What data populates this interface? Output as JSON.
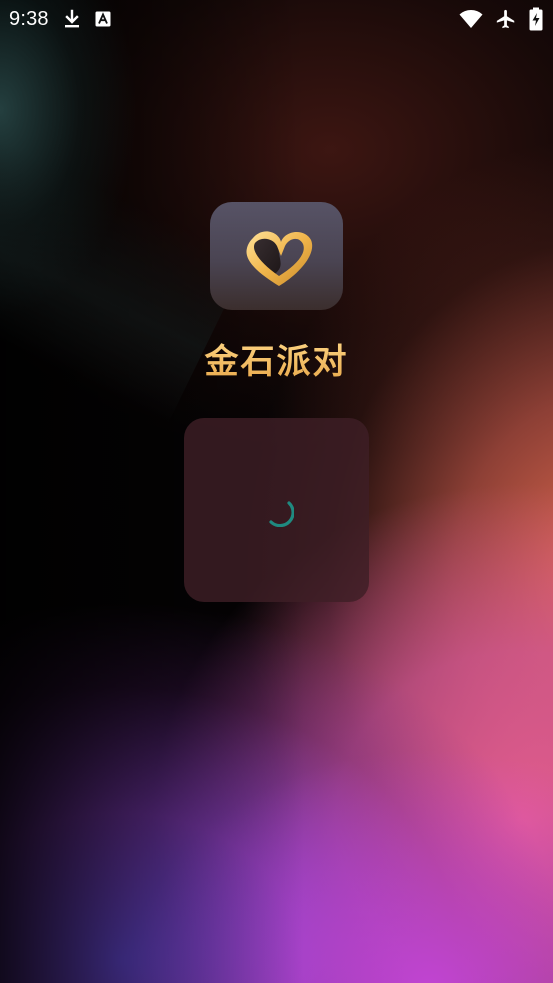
{
  "status_bar": {
    "time": "9:38",
    "icons": [
      "download-icon",
      "text-a-icon",
      "wifi-icon",
      "airplane-icon",
      "battery-charging-icon"
    ]
  },
  "splash": {
    "app_name": "金石派对",
    "logo_icon": "gold-heart-logo-icon"
  },
  "loading": {
    "indicator": "spinner-icon",
    "color": "#1f8a80"
  },
  "colors": {
    "brand_gold": "#f2bf63",
    "dialog_bg": "#3e1e26"
  }
}
